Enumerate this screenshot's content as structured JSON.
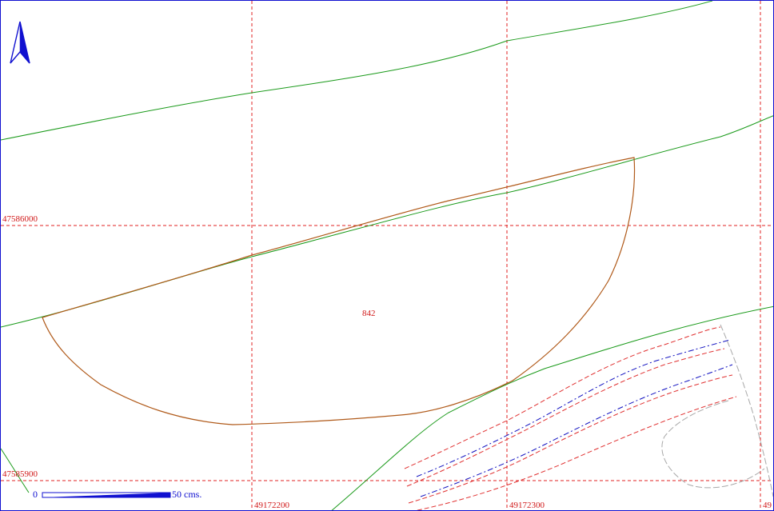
{
  "map": {
    "parcel_label": "842",
    "grid": {
      "northings": [
        "47586000",
        "47585900"
      ],
      "eastings": [
        "49172200",
        "49172300",
        "49"
      ]
    },
    "scale_bar": {
      "start": "0",
      "end": "50 cms."
    },
    "colors": {
      "grid": "#e02020",
      "parcel": "#b05a1a",
      "contour": "#1a9a1a",
      "stream": "#1010c0",
      "stream_bank": "#e03030",
      "road": "#a0a0a0",
      "north_arrow": "#1010d0",
      "frame": "#1010d0"
    },
    "icons": {
      "north": "north-arrow-icon"
    }
  }
}
